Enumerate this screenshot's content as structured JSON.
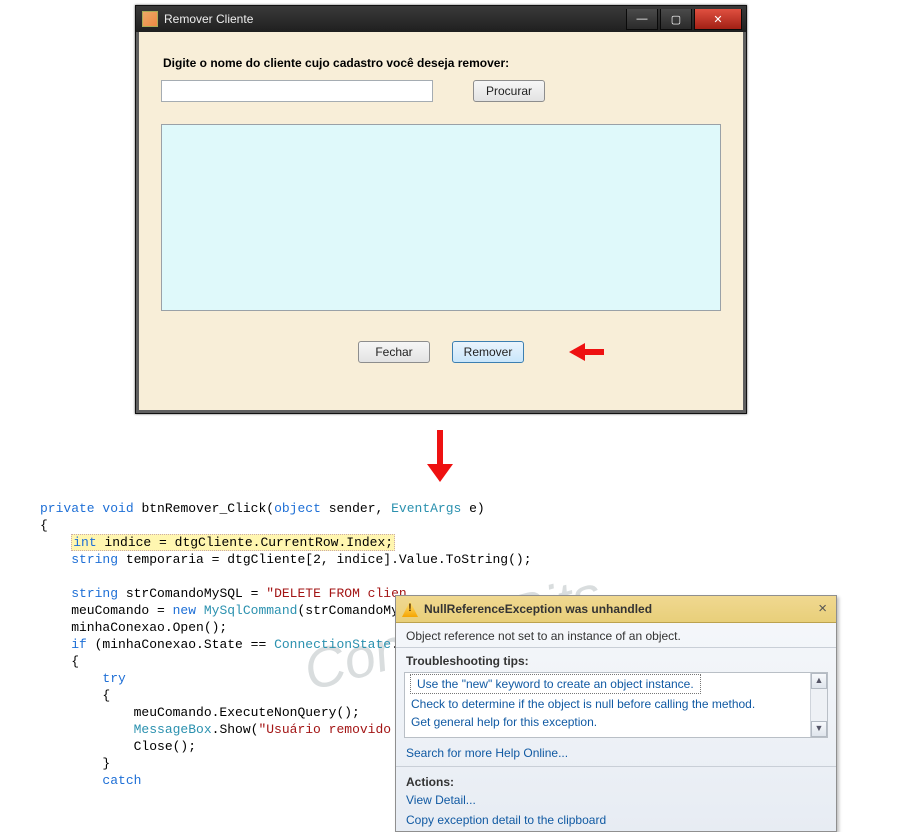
{
  "watermark": "Contém Bits",
  "window": {
    "title": "Remover Cliente",
    "prompt": "Digite o nome do cliente cujo cadastro você deseja remover:",
    "search_button": "Procurar",
    "close_button": "Fechar",
    "remove_button": "Remover"
  },
  "code": {
    "l1a": "private",
    "l1b": "void",
    "l1c": " btnRemover_Click(",
    "l1d": "object",
    "l1e": " sender, ",
    "l1f": "EventArgs",
    "l1g": " e)",
    "l2": "{",
    "l3a": "    ",
    "l3b": "int",
    "l3c": " indice = dtgCliente.CurrentRow.Index;",
    "l4a": "    ",
    "l4b": "string",
    "l4c": " temporaria = dtgCliente[2, indice].Value.ToString();",
    "l5": "",
    "l6a": "    ",
    "l6b": "string",
    "l6c": " strComandoMySQL = ",
    "l6d": "\"DELETE FROM clien",
    "l7a": "    meuComando = ",
    "l7b": "new",
    "l7c": " ",
    "l7d": "MySqlCommand",
    "l7e": "(strComandoMyS",
    "l8": "    minhaConexao.Open();",
    "l9a": "    ",
    "l9b": "if",
    "l9c": " (minhaConexao.State == ",
    "l9d": "ConnectionState",
    "l9e": ".",
    "l10": "    {",
    "l11a": "        ",
    "l11b": "try",
    "l12": "        {",
    "l13": "            meuComando.ExecuteNonQuery();",
    "l14a": "            ",
    "l14b": "MessageBox",
    "l14c": ".Show(",
    "l14d": "\"Usuário removido c",
    "l15": "            Close();",
    "l16": "        }",
    "l17a": "        ",
    "l17b": "catch"
  },
  "exception": {
    "title": "NullReferenceException was unhandled",
    "desc": "Object reference not set to an instance of an object.",
    "tips_heading": "Troubleshooting tips:",
    "tip1": "Use the \"new\" keyword to create an object instance.",
    "tip2": "Check to determine if the object is null before calling the method.",
    "tip3": "Get general help for this exception.",
    "search": "Search for more Help Online...",
    "actions_heading": "Actions:",
    "view_detail": "View Detail...",
    "copy": "Copy exception detail to the clipboard"
  }
}
